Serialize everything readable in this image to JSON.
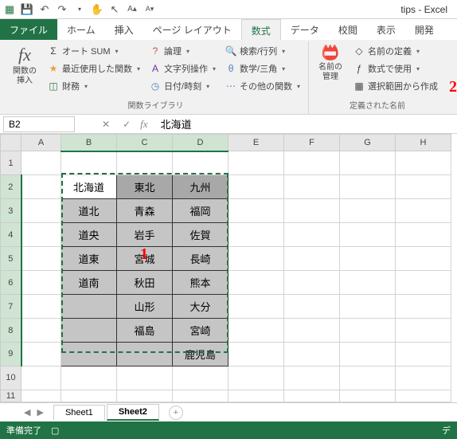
{
  "title": "tips - Excel",
  "tabs": {
    "file": "ファイル",
    "home": "ホーム",
    "insert": "挿入",
    "pagelayout": "ページ レイアウト",
    "formulas": "数式",
    "data": "データ",
    "review": "校閲",
    "view": "表示",
    "dev": "開発"
  },
  "ribbon": {
    "insert_fn": {
      "icon": "fx",
      "label": "関数の\n挿入"
    },
    "autosum": "オート SUM",
    "recent": "最近使用した関数",
    "financial": "財務",
    "logical": "論理",
    "text": "文字列操作",
    "datetime": "日付/時刻",
    "lookup": "検索/行列",
    "math": "数学/三角",
    "other": "その他の関数",
    "lib_label": "関数ライブラリ",
    "name_mgr": {
      "label": "名前の\n管理"
    },
    "define_name": "名前の定義",
    "use_in_formula": "数式で使用",
    "create_from_sel": "選択範囲から作成",
    "names_label": "定義された名前"
  },
  "name_box": "B2",
  "formula_value": "北海道",
  "columns": [
    "A",
    "B",
    "C",
    "D",
    "E",
    "F",
    "G",
    "H"
  ],
  "rows": [
    "1",
    "2",
    "3",
    "4",
    "5",
    "6",
    "7",
    "8",
    "9",
    "10",
    "11"
  ],
  "data": {
    "r2": {
      "B": "北海道",
      "C": "東北",
      "D": "九州"
    },
    "r3": {
      "B": "道北",
      "C": "青森",
      "D": "福岡"
    },
    "r4": {
      "B": "道央",
      "C": "岩手",
      "D": "佐賀"
    },
    "r5": {
      "B": "道東",
      "C": "宮城",
      "D": "長崎"
    },
    "r6": {
      "B": "道南",
      "C": "秋田",
      "D": "熊本"
    },
    "r7": {
      "B": "",
      "C": "山形",
      "D": "大分"
    },
    "r8": {
      "B": "",
      "C": "福島",
      "D": "宮崎"
    },
    "r9": {
      "B": "",
      "C": "",
      "D": "鹿児島"
    }
  },
  "sheets": {
    "s1": "Sheet1",
    "s2": "Sheet2"
  },
  "status": "準備完了",
  "annotations": {
    "a1": "1",
    "a2": "2"
  }
}
